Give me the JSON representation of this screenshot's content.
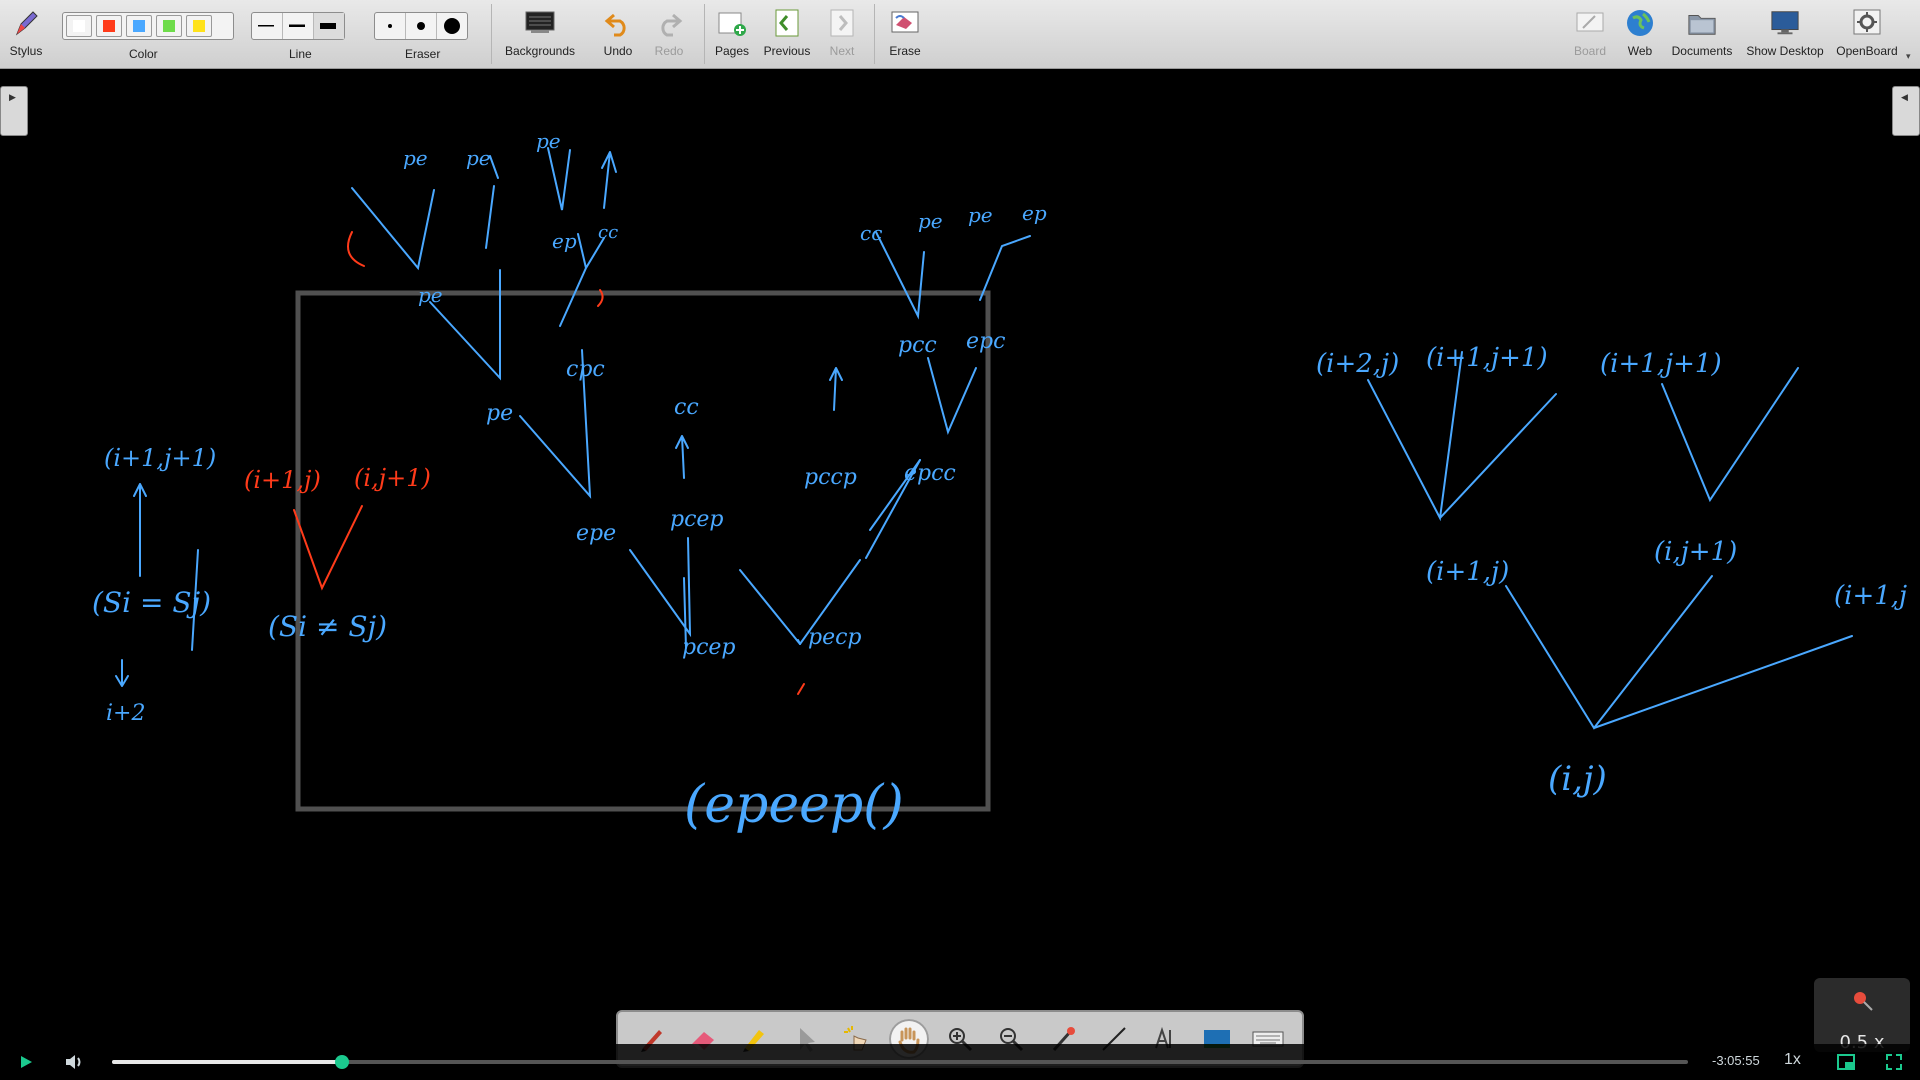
{
  "toolbar": {
    "stylus": "Stylus",
    "color": "Color",
    "line": "Line",
    "eraser": "Eraser",
    "backgrounds": "Backgrounds",
    "undo": "Undo",
    "redo": "Redo",
    "pages": "Pages",
    "previous": "Previous",
    "next": "Next",
    "erase": "Erase",
    "board": "Board",
    "web": "Web",
    "documents": "Documents",
    "show_desktop": "Show Desktop",
    "openboard": "OpenBoard"
  },
  "colors": [
    "#ffffff",
    "#ff3b1a",
    "#4aa8ff",
    "#6edc4a",
    "#ffe21a"
  ],
  "ink": {
    "blue": "#4aa8ff",
    "red": "#ff3b1a",
    "frame": "#505050"
  },
  "board_text": {
    "top_left_nodes": [
      "pe",
      "pe",
      "pe",
      "cc",
      "pe",
      "cc",
      "pe",
      "ep",
      "cpc",
      "epe",
      "pccp",
      "pcep",
      "epcc",
      "pcc",
      "epc",
      "pecp",
      "epeep"
    ],
    "result": "(epeep()",
    "left_rule": [
      "(i+1,j+1)",
      "(Si = Sj)",
      "i+2"
    ],
    "left_rule_red": [
      "(i+1,j)",
      "(i,j+1)"
    ],
    "left_rule_blue": "(Si ≠ Sj)",
    "right_tree": [
      "(i+2,j)",
      "(i+1,j+1)",
      "(i+1,j+1)",
      "(i+1,j)",
      "(i,j+1)",
      "(i+1,j",
      "(i,j)"
    ]
  },
  "zoom": {
    "label": "0.5 x"
  },
  "player": {
    "time_remaining": "-3:05:55",
    "speed": "1x",
    "progress_fraction": 0.146
  }
}
